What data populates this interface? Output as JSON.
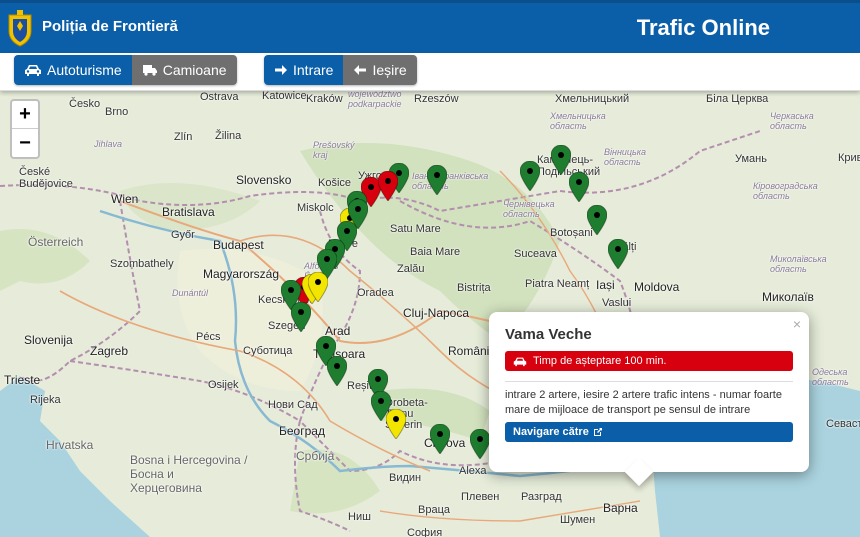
{
  "header": {
    "brand": "Poliția de Frontieră",
    "title": "Trafic Online",
    "bg_color": "#0b5fa8"
  },
  "toolbar": {
    "vehicle": {
      "cars": "Autoturisme",
      "trucks": "Camioane",
      "selected": "Autoturisme"
    },
    "direction": {
      "entry": "Intrare",
      "exit": "Ieșire",
      "selected": "Intrare"
    }
  },
  "zoom": {
    "in": "+",
    "out": "−"
  },
  "map": {
    "labels": {
      "cesko": "Česko",
      "ceske_budejovice": "České\nBudějovice",
      "brno": "Brno",
      "zlin": "Zlín",
      "zilina": "Žilina",
      "jihlava": "Jihlava",
      "ostrava": "Ostrava",
      "katowice": "Katowice",
      "krakow": "Kraków",
      "wojewodztwo": "województwo\npodkarpackie",
      "rzeszow": "Rzeszów",
      "presovsky": "Prešovský\nkraj",
      "kosice": "Košice",
      "slovensko": "Slovensko",
      "uzhgorod": "Ужгород",
      "miskolc": "Miskolc",
      "wien": "Wien",
      "bratislava": "Bratislava",
      "gyor": "Győr",
      "osterreich": "Österreich",
      "budapest": "Budapest",
      "szombathely": "Szombathely",
      "magyarorszag": "Magyarország",
      "kecskemet": "Kecskemét",
      "dunantul": "Dunántúl",
      "slovenija": "Slovenija",
      "zagreb": "Zagreb",
      "pecs": "Pécs",
      "szeged": "Szeged",
      "subotica": "Суботица",
      "osijek": "Osijek",
      "trieste": "Trieste",
      "rijeka": "Rijeka",
      "hrvatska": "Hrvatska",
      "novi_sad": "Нови Сад",
      "beograd": "Београд",
      "bosna": "Bosna i Hercegovina /\nБосна и\nХерцеговина",
      "srbija": "Србија",
      "ivano": "Івано-Франківська\nобласть",
      "chernivtsi": "Чернівецька\nобласть",
      "kamyanets": "Кам'янець-\nПодільський",
      "khmelnytska": "Хмельницька\nобласть",
      "vinnytska": "Вінницька\nобласть",
      "bila_tserkva": "Біла Церква",
      "cherkaska": "Черкаська\nобласть",
      "uman": "Умань",
      "kirovohradska": "Кіровоградська\nобласть",
      "mykolaiv": "Миколаїв",
      "mykolaivska": "Миколаївська\nобласть",
      "khmelnytskyi": "Хмельницький",
      "moldova": "Moldova",
      "balti": "Bălți",
      "iasi": "Iași",
      "vaslui": "Vaslui",
      "botosani": "Botoșani",
      "suceava": "Suceava",
      "satu_mare": "Satu Mare",
      "baia_mare": "Baia Mare",
      "debrecen": "Debre",
      "zalau": "Zalău",
      "oradea": "Oradea",
      "alfold": "Alföld és\nÉszak",
      "bistrita": "Bistrița",
      "piatra": "Piatra Neamț",
      "cluj": "Cluj-Napoca",
      "arad": "Arad",
      "timisoara": "Timișoara",
      "romania": "România",
      "resita": "Reșita",
      "drobeta": "Drobeta-\nTurnu\nSeverin",
      "craiova": "Craiova",
      "vidin": "Видин",
      "pleven": "Плевен",
      "razgrad": "Разград",
      "alexandria": "Alexa",
      "vratsa": "Враца",
      "shumen": "Шумен",
      "varna": "Варна",
      "sofia": "София",
      "nis": "Ниш",
      "odeska": "Одеська\nобласть",
      "sevastopol": "Севаст",
      "kryvbas": "Криви"
    },
    "markers": [
      {
        "color": "green"
      },
      {
        "color": "red"
      },
      {
        "color": "red"
      },
      {
        "color": "green"
      },
      {
        "color": "green"
      },
      {
        "color": "green"
      },
      {
        "color": "green"
      },
      {
        "color": "green"
      },
      {
        "color": "green"
      },
      {
        "color": "green"
      },
      {
        "color": "yellow"
      },
      {
        "color": "green"
      },
      {
        "color": "green"
      },
      {
        "color": "green"
      },
      {
        "color": "green"
      },
      {
        "color": "red"
      },
      {
        "color": "yellow"
      },
      {
        "color": "yellow"
      },
      {
        "color": "green"
      },
      {
        "color": "green"
      },
      {
        "color": "green"
      },
      {
        "color": "green"
      },
      {
        "color": "green"
      },
      {
        "color": "green"
      },
      {
        "color": "green"
      },
      {
        "color": "yellow"
      },
      {
        "color": "green"
      },
      {
        "color": "green"
      },
      {
        "color": "green"
      },
      {
        "color": "red"
      }
    ]
  },
  "popup": {
    "title": "Vama Veche",
    "wait": "Timp de așteptare 100 min.",
    "description": "intrare 2 artere, iesire 2 artere trafic intens - numar foarte mare de mijloace de transport pe sensul de intrare",
    "navigate": "Navigare către",
    "close": "×"
  }
}
